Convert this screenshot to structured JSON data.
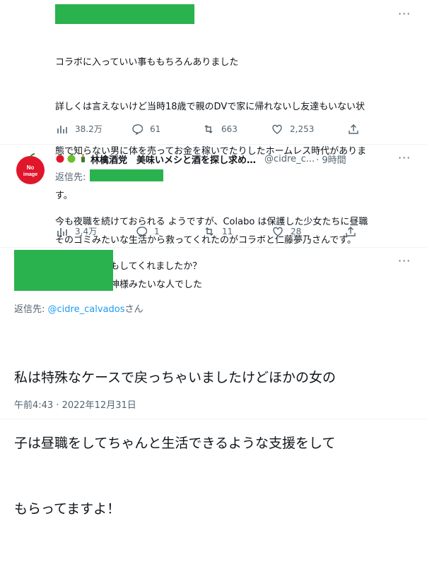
{
  "tweet1": {
    "lines": [
      "コラボに入っていい事ももちろんありました",
      "詳しくは言えないけど当時18歳で親のDVで家に帰れないし友達もいない状",
      "態で知らない男に体を売ってお金を稼いでたりしたホームレス時代がありま",
      "す。",
      "そのゴミみたいな生活から救ってくれたのがコラボと仁藤夢乃さんです。",
      "本当に当時は神様みたいな人でした"
    ],
    "stats": {
      "views": "38.2万",
      "replies": "61",
      "retweets": "663",
      "likes": "2,253"
    }
  },
  "tweet2": {
    "display_name": "林檎酒党　美味いメシと酒を探し求め…",
    "handle": "@cidre_c...",
    "time": "· 9時間",
    "reply_to_label": "返信先:",
    "avatar_text": "No\nimage",
    "lines": [
      "今も夜職を続けておられる ようですが、Colabo は保護した少女たちに昼職",
      "に繋がる支援もしてくれましたか？"
    ],
    "stats": {
      "views": "3.4万",
      "replies": "1",
      "retweets": "11",
      "likes": "28"
    }
  },
  "tweet3": {
    "reply_to_label": "返信先:",
    "reply_to_handle": "@cidre_calvados",
    "reply_to_suffix": "さん",
    "lines": [
      "私は特殊なケースで戻っちゃいましたけどほかの女の",
      "子は昼職をしてちゃんと生活できるような支援をして",
      "もらってますよ！"
    ],
    "timestamp": "午前4:43 · 2022年12月31日"
  },
  "colors": {
    "redaction": "#2ab24f",
    "link": "#1d9bf0",
    "muted": "#536471"
  },
  "icons": [
    "views-icon",
    "reply-icon",
    "retweet-icon",
    "like-icon",
    "share-icon",
    "more-icon",
    "apple-icon"
  ]
}
